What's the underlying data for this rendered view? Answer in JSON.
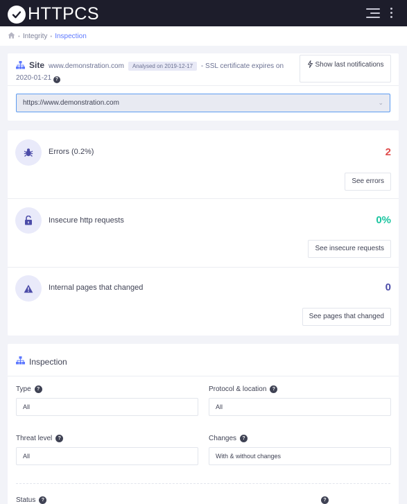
{
  "app": {
    "title": "HTTPCS"
  },
  "header": {
    "menu_icon": "hamburger-icon",
    "more_icon": "kebab-icon"
  },
  "breadcrumb": {
    "home_icon": "home-icon",
    "items": [
      "Integrity",
      "Inspection"
    ]
  },
  "site": {
    "title": "Site",
    "domain": "www.demonstration.com",
    "analysed_badge": "Analysed on 2019-12-17",
    "ssl_text": "- SSL certificate expires on",
    "ssl_date": "2020-01-21",
    "help_glyph": "?",
    "show_button": "Show last notifications",
    "url_select_value": "https://www.demonstration.com"
  },
  "stats": [
    {
      "label": "Errors (0.2%)",
      "value": "2",
      "color": "#e04b4b",
      "icon": "bug-icon",
      "button": "See errors"
    },
    {
      "label": "Insecure http requests",
      "value": "0%",
      "color": "#1bc5a0",
      "icon": "unlock-icon",
      "button": "See insecure requests"
    },
    {
      "label": "Internal pages that changed",
      "value": "0",
      "color": "#4c4ca8",
      "icon": "warning-icon",
      "button": "See pages that changed"
    }
  ],
  "inspection": {
    "title": "Inspection",
    "fields": {
      "type": {
        "label": "Type",
        "value": "All"
      },
      "protocol": {
        "label": "Protocol & location",
        "value": "All"
      },
      "threat": {
        "label": "Threat level",
        "value": "All"
      },
      "changes": {
        "label": "Changes",
        "value": "With & without changes"
      },
      "status": {
        "label": "Status"
      }
    }
  },
  "colors": {
    "topbar": "#1d1d2b",
    "accent": "#5d78ff",
    "icon_bg": "#e9eafa",
    "icon_fg": "#4c4ca8"
  }
}
